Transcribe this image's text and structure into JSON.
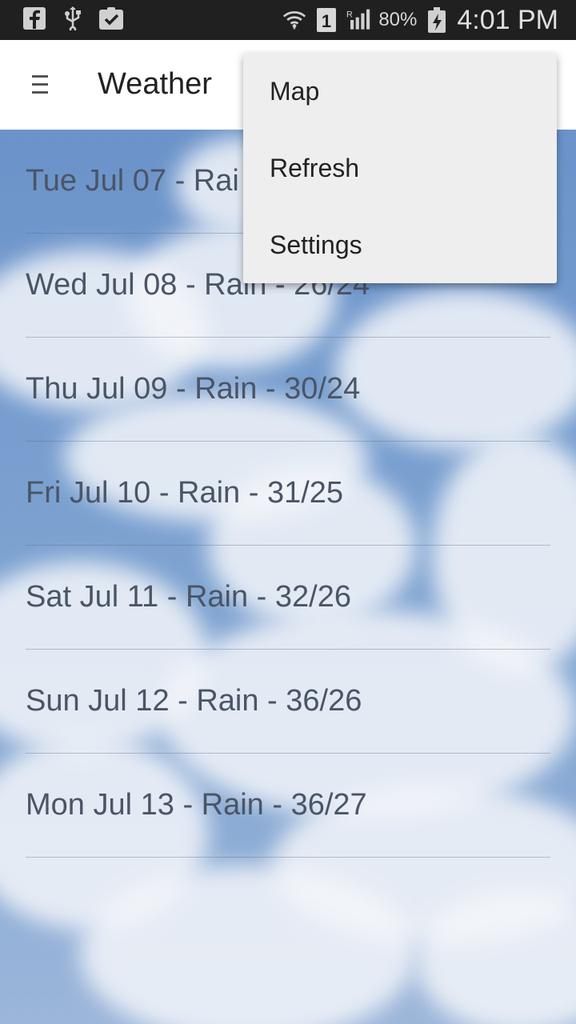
{
  "status_bar": {
    "left_icons": [
      "facebook-icon",
      "usb-icon",
      "clipboard-check-icon"
    ],
    "right_icons": [
      "wifi-icon",
      "sim-1-icon",
      "roaming-signal-icon",
      "battery-charging-icon"
    ],
    "battery_percent": "80%",
    "time": "4:01 PM"
  },
  "app_bar": {
    "title": "Weather"
  },
  "forecast": [
    {
      "text": "Tue Jul 07 - Rai"
    },
    {
      "text": "Wed Jul 08 - Rain - 26/24"
    },
    {
      "text": "Thu Jul 09 - Rain - 30/24"
    },
    {
      "text": "Fri Jul 10 - Rain - 31/25"
    },
    {
      "text": "Sat Jul 11 - Rain - 32/26"
    },
    {
      "text": "Sun Jul 12 - Rain - 36/26"
    },
    {
      "text": "Mon Jul 13 - Rain - 36/27"
    }
  ],
  "overflow_menu": {
    "items": [
      {
        "label": "Map"
      },
      {
        "label": "Refresh"
      },
      {
        "label": "Settings"
      }
    ]
  }
}
